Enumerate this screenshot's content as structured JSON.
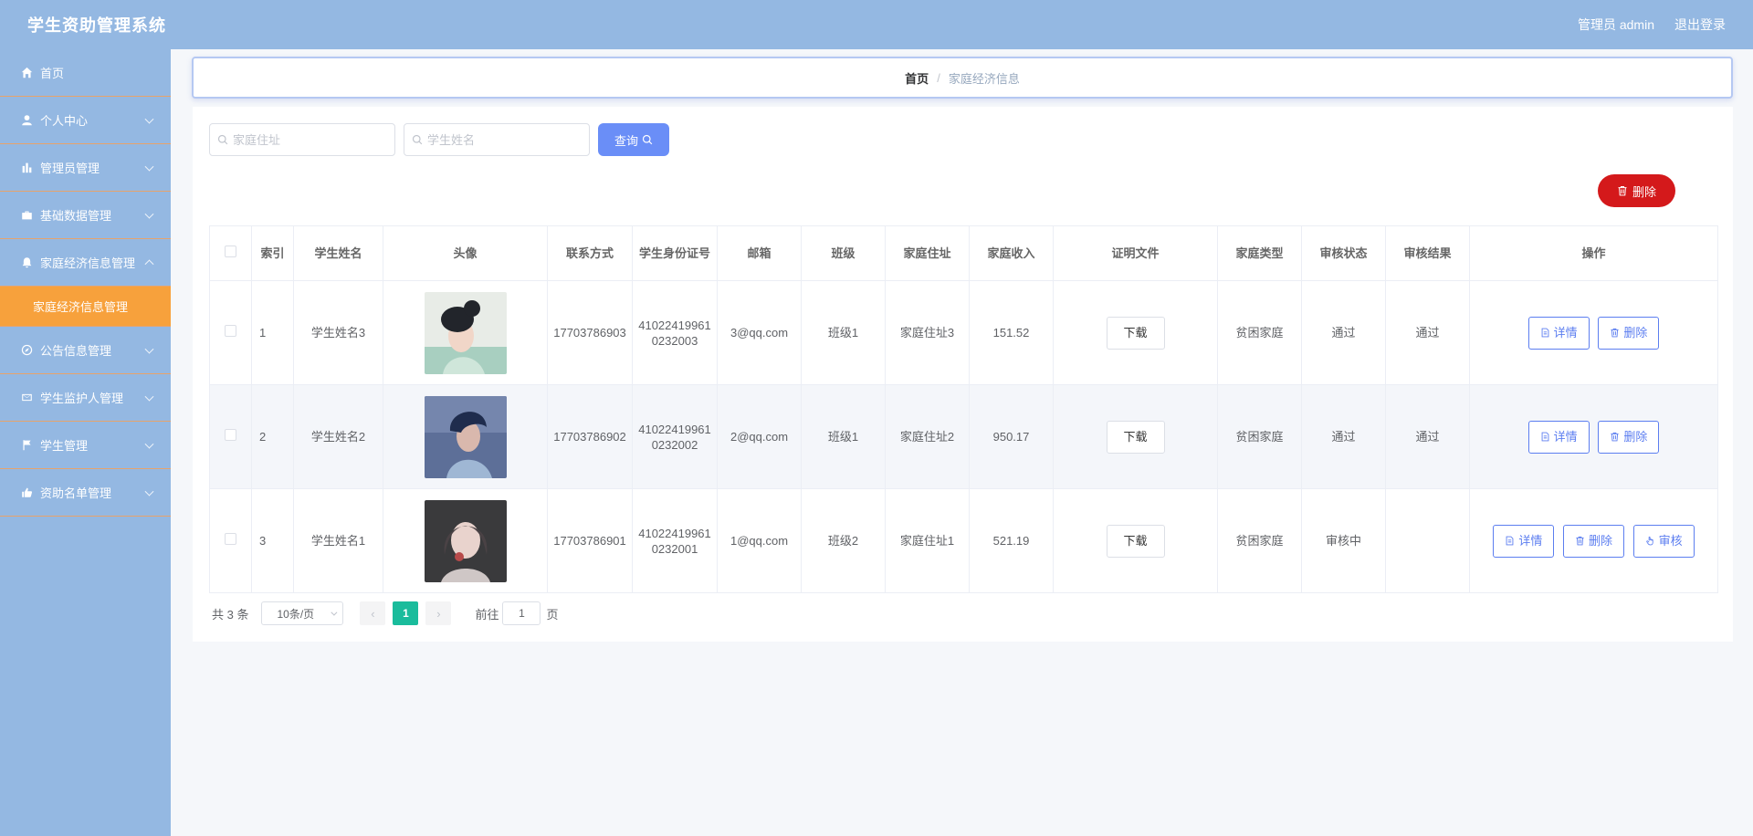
{
  "header": {
    "title": "学生资助管理系统",
    "user_label": "管理员 admin",
    "logout_label": "退出登录"
  },
  "sidebar": {
    "items": [
      {
        "label": "首页",
        "icon": "home-icon"
      },
      {
        "label": "个人中心",
        "icon": "user-icon"
      },
      {
        "label": "管理员管理",
        "icon": "bar-chart-icon"
      },
      {
        "label": "基础数据管理",
        "icon": "briefcase-icon"
      },
      {
        "label": "家庭经济信息管理",
        "icon": "bell-icon"
      },
      {
        "label": "公告信息管理",
        "icon": "compass-icon"
      },
      {
        "label": "学生监护人管理",
        "icon": "mail-icon"
      },
      {
        "label": "学生管理",
        "icon": "flag-icon"
      },
      {
        "label": "资助名单管理",
        "icon": "thumb-icon"
      }
    ],
    "active_sub": "家庭经济信息管理"
  },
  "breadcrumb": {
    "home": "首页",
    "separator": "/",
    "current": "家庭经济信息"
  },
  "search": {
    "address_placeholder": "家庭住址",
    "name_placeholder": "学生姓名",
    "query_label": "查询",
    "delete_label": "删除"
  },
  "table": {
    "headers": [
      "索引",
      "学生姓名",
      "头像",
      "联系方式",
      "学生身份证号",
      "邮箱",
      "班级",
      "家庭住址",
      "家庭收入",
      "证明文件",
      "家庭类型",
      "审核状态",
      "审核结果",
      "操作"
    ],
    "download_label": "下载",
    "detail_label": "详情",
    "delete_label": "删除",
    "audit_label": "审核",
    "rows": [
      {
        "index": "1",
        "name": "学生姓名3",
        "phone": "17703786903",
        "id_card": "410224199610232003",
        "email": "3@qq.com",
        "class": "班级1",
        "address": "家庭住址3",
        "income": "151.52",
        "family_type": "贫困家庭",
        "audit_status": "通过",
        "audit_result": "通过"
      },
      {
        "index": "2",
        "name": "学生姓名2",
        "phone": "17703786902",
        "id_card": "410224199610232002",
        "email": "2@qq.com",
        "class": "班级1",
        "address": "家庭住址2",
        "income": "950.17",
        "family_type": "贫困家庭",
        "audit_status": "通过",
        "audit_result": "通过"
      },
      {
        "index": "3",
        "name": "学生姓名1",
        "phone": "17703786901",
        "id_card": "410224199610232001",
        "email": "1@qq.com",
        "class": "班级2",
        "address": "家庭住址1",
        "income": "521.19",
        "family_type": "贫困家庭",
        "audit_status": "审核中",
        "audit_result": ""
      }
    ]
  },
  "pagination": {
    "total": "共 3 条",
    "page_size": "10条/页",
    "current_page": "1",
    "goto_label": "前往",
    "goto_value": "1",
    "page_suffix": "页"
  },
  "colors": {
    "sidebar_bg": "#94b8e2",
    "active_sub_bg": "#f7a13c",
    "query_btn": "#6a8ef7",
    "delete_btn": "#d4191b",
    "page_active": "#1abc9c",
    "op_btn": "#5c7ef0"
  }
}
